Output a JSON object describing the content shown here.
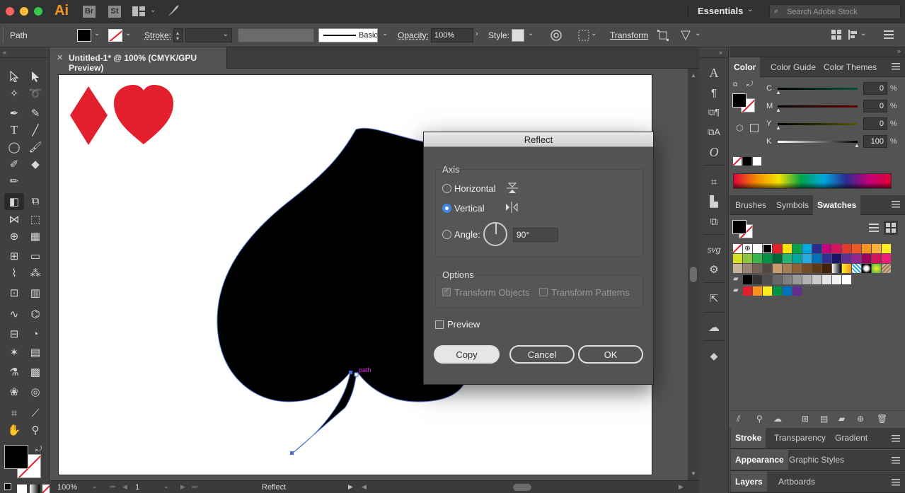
{
  "app": {
    "logo": "Ai",
    "bridge_icon": "Br",
    "stock_icon": "St",
    "workspace": "Essentials",
    "search_placeholder": "Search Adobe Stock"
  },
  "control_bar": {
    "selection_type": "Path",
    "stroke_label": "Stroke:",
    "brush_label": "Basic",
    "opacity_label": "Opacity:",
    "opacity_value": "100%",
    "style_label": "Style:",
    "transform_label": "Transform"
  },
  "document": {
    "tab_title": "Untitled-1* @ 100% (CMYK/GPU Preview)",
    "close_glyph": "✕",
    "path_hint": "path"
  },
  "dialog": {
    "title": "Reflect",
    "axis_label": "Axis",
    "horizontal_label": "Horizontal",
    "vertical_label": "Vertical",
    "angle_label": "Angle:",
    "angle_value": "90°",
    "options_label": "Options",
    "transform_objects": "Transform Objects",
    "transform_patterns": "Transform Patterns",
    "preview_label": "Preview",
    "copy_label": "Copy",
    "cancel_label": "Cancel",
    "ok_label": "OK",
    "selected_axis": "vertical"
  },
  "color_panel": {
    "tabs": [
      "Color",
      "Color Guide",
      "Color Themes"
    ],
    "channels": [
      {
        "label": "C",
        "value": "0"
      },
      {
        "label": "M",
        "value": "0"
      },
      {
        "label": "Y",
        "value": "0"
      },
      {
        "label": "K",
        "value": "100"
      }
    ],
    "percent": "%"
  },
  "swatches_panel": {
    "tabs": [
      "Brushes",
      "Symbols",
      "Swatches"
    ]
  },
  "lower_panels": {
    "row1": [
      "Stroke",
      "Transparency",
      "Gradient"
    ],
    "row2": [
      "Appearance",
      "Graphic Styles"
    ],
    "row3": [
      "Layers",
      "Artboards"
    ]
  },
  "status": {
    "zoom": "100%",
    "page": "1",
    "tool": "Reflect"
  },
  "colors": {
    "suit_red": "#e31e2d",
    "accent_blue": "#3d88e0",
    "path_magenta": "#e02ce0"
  }
}
